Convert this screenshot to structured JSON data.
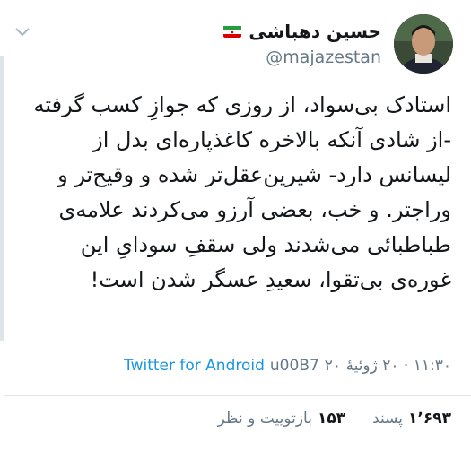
{
  "author": {
    "display_name": "حسین دهباشی",
    "handle": "@majazestan",
    "flag_icon": "iran-flag-icon"
  },
  "tweet": {
    "text": "استادک بی‌سواد، از روزی که جوازِ کسب گرفته -از شادی آنکه بالاخره کاغذپاره‌ای بدل از لیسانس دارد- شیرین‌عقل‌تر شده و وقیح‌تر و وراجتر. و خب، بعضی آرزو می‌کردند علامه‌ی طباطبائی می‌شدند ولی سقفِ سودایِ این غوره‌ی بی‌تقوا، سعیدِ عسگر شدن است!"
  },
  "meta": {
    "time": "۱۱:۳۰ · ۲۰ ژوئیهٔ ۲۰",
    "separator": "u00B7",
    "client": "Twitter for Android"
  },
  "stats": {
    "retweets_count": "۱۵۳",
    "retweets_label": "بازتوییت و نظر",
    "likes_count": "۱٬۶۹۳",
    "likes_label": "پسند"
  },
  "colors": {
    "text": "#14171a",
    "secondary": "#657786",
    "link": "#1b95e0",
    "divider": "#e1e8ed"
  }
}
